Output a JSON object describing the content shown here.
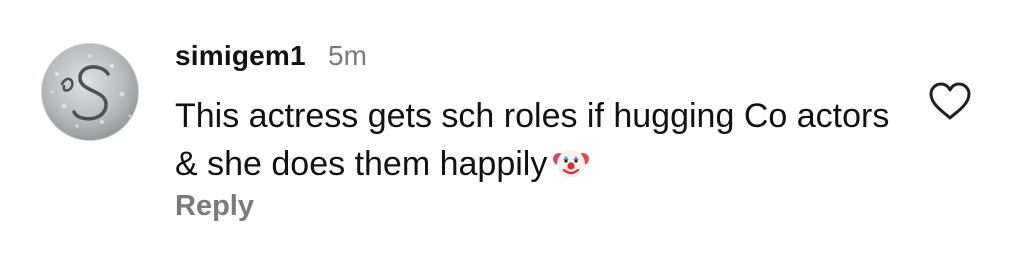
{
  "comment": {
    "username": "simigem1",
    "timestamp": "5m",
    "text": "This actress gets sch roles if hugging Co actors & she does them happily",
    "emoji": "clown-face",
    "reply_label": "Reply",
    "like_icon": "heart-outline-icon",
    "colors": {
      "text": "#111111",
      "muted": "#7a7a7a"
    }
  }
}
